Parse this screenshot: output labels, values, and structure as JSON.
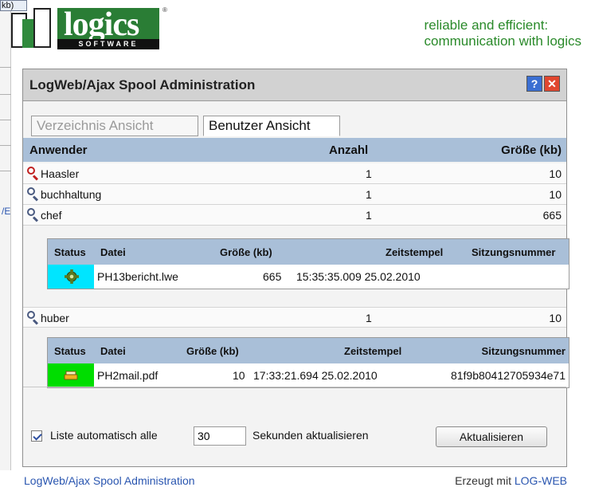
{
  "background": {
    "tab_label": "kb)",
    "link_fragment": "/E"
  },
  "logo": {
    "text": "logics",
    "sub": "SOFTWARE",
    "reg": "®"
  },
  "tagline": {
    "line1": "reliable and efficient:",
    "line2": "communication with logics"
  },
  "window": {
    "title": "LogWeb/Ajax Spool Administration",
    "help_label": "?",
    "close_label": "✕",
    "tabs": [
      "Verzeichnis Ansicht",
      "Benutzer Ansicht"
    ],
    "active_tab": "Benutzer Ansicht",
    "columns": {
      "user": "Anwender",
      "count": "Anzahl",
      "size": "Größe (kb)"
    },
    "users": [
      {
        "name": "Haasler",
        "count": "1",
        "size": "10",
        "icon": "magnifier-red-icon"
      },
      {
        "name": "buchhaltung",
        "count": "1",
        "size": "10",
        "icon": "magnifier-icon"
      },
      {
        "name": "chef",
        "count": "1",
        "size": "665",
        "icon": "magnifier-icon"
      },
      {
        "name": "huber",
        "count": "1",
        "size": "10",
        "icon": "magnifier-icon"
      }
    ],
    "subtable_columns": {
      "status": "Status",
      "file": "Datei",
      "size": "Größe (kb)",
      "timestamp": "Zeitstempel",
      "session": "Sitzungsnummer"
    },
    "chef_jobs": [
      {
        "status_color": "#00e5ff",
        "status_icon": "gear-icon",
        "file": "PH13bericht.lwe",
        "size": "665",
        "timestamp": "15:35:35.009 25.02.2010",
        "session": ""
      }
    ],
    "huber_jobs": [
      {
        "status_color": "#00dd00",
        "status_icon": "printer-icon",
        "file": "PH2mail.pdf",
        "size": "10",
        "timestamp": "17:33:21.694 25.02.2010",
        "session": "81f9b80412705934e71"
      }
    ],
    "auto_refresh": {
      "checked": true,
      "label_before": "Liste automatisch alle",
      "interval": "30",
      "label_after": "Sekunden aktualisieren"
    },
    "refresh_button": "Aktualisieren"
  },
  "footer": {
    "left": "LogWeb/Ajax Spool Administration",
    "right_prefix": "Erzeugt mit ",
    "right_link": "LOG-WEB"
  },
  "colors": {
    "header_blue": "#a9bfd8",
    "tagline_green": "#2a8a2a",
    "link_blue": "#2a56b0"
  }
}
